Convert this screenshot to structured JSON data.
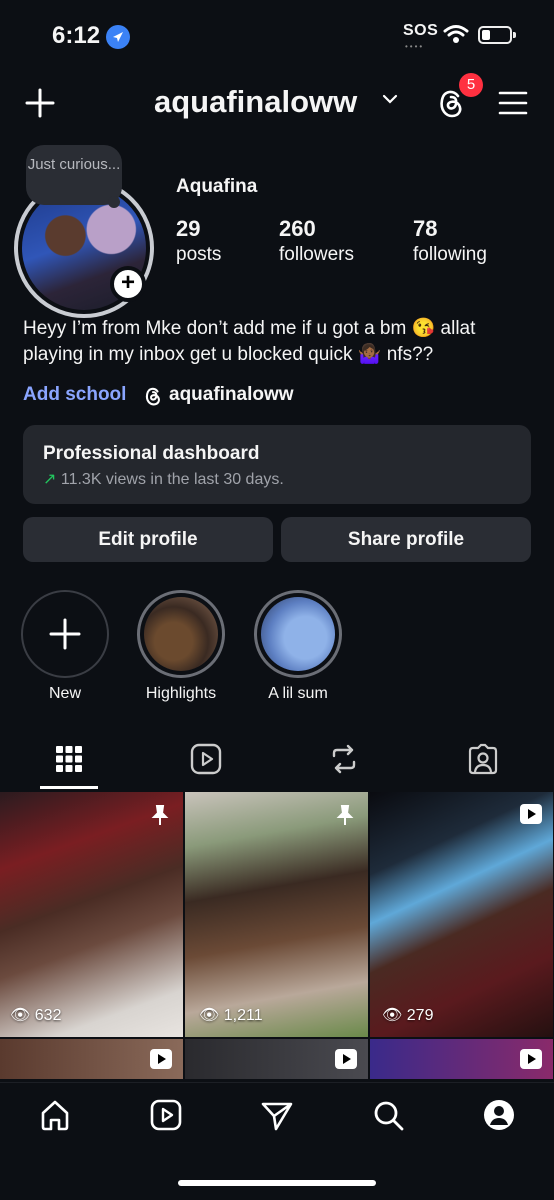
{
  "status_bar": {
    "time": "6:12",
    "sos": "SOS"
  },
  "header": {
    "username": "aquafinaloww",
    "notification_count": "5"
  },
  "profile": {
    "note": "Just curious...",
    "display_name": "Aquafina",
    "stats": [
      {
        "value": "29",
        "label": "posts"
      },
      {
        "value": "260",
        "label": "followers"
      },
      {
        "value": "78",
        "label": "following"
      }
    ],
    "bio": "Heyy I’m from Mke don’t add me if u got a bm 😘 allat playing in my inbox get u blocked quick 🤷🏾‍♀️ nfs??",
    "add_school": "Add school",
    "threads_handle": "aquafinaloww"
  },
  "dashboard": {
    "title": "Professional dashboard",
    "subtitle": "11.3K views in the last 30 days."
  },
  "buttons": {
    "edit": "Edit profile",
    "share": "Share profile"
  },
  "highlights": [
    {
      "label": "New"
    },
    {
      "label": "Highlights"
    },
    {
      "label": "A lil sum"
    }
  ],
  "tabs": [
    "grid-icon",
    "reels-icon",
    "reposts-icon",
    "tagged-icon"
  ],
  "posts": [
    {
      "views": "632",
      "pinned": true
    },
    {
      "views": "1,211",
      "pinned": true
    },
    {
      "views": "279",
      "reel": true
    }
  ],
  "bottom_nav": [
    "home-icon",
    "reels-icon",
    "direct-icon",
    "search-icon",
    "profile-icon"
  ],
  "colors": {
    "background": "#0c0f14",
    "accent_link": "#8aa5ff",
    "badge": "#ff3040",
    "trend_up": "#22c55e"
  }
}
